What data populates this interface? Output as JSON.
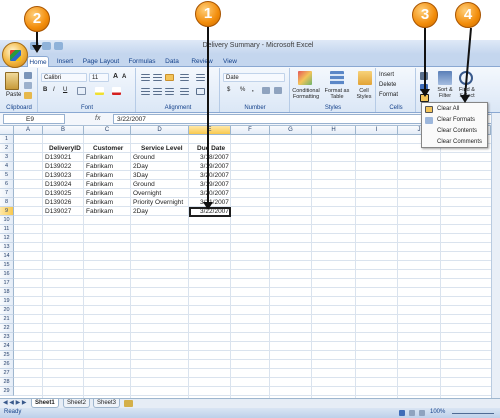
{
  "window": {
    "title": "Delivery Summary - Microsoft Excel"
  },
  "tabs": [
    "Home",
    "Insert",
    "Page Layout",
    "Formulas",
    "Data",
    "Review",
    "View"
  ],
  "ribbon": {
    "clipboard": {
      "label": "Clipboard",
      "paste": "Paste"
    },
    "font": {
      "label": "Font",
      "name": "Calibri",
      "size": "11",
      "bold": "B",
      "italic": "I",
      "underline": "U",
      "grow": "A",
      "shrink": "A"
    },
    "alignment": {
      "label": "Alignment"
    },
    "number": {
      "label": "Number",
      "format": "Date",
      "currency": "$",
      "percent": "%",
      "comma": ","
    },
    "styles": {
      "label": "Styles",
      "conditional": "Conditional Formatting",
      "format_table": "Format as Table",
      "cell_styles": "Cell Styles"
    },
    "cells": {
      "label": "Cells",
      "insert": "Insert",
      "delete": "Delete",
      "format": "Format"
    },
    "editing": {
      "sort": "Sort & Filter",
      "find": "Find & Select"
    }
  },
  "formula_bar": {
    "name_box": "E9",
    "fx": "fx",
    "value": "3/22/2007"
  },
  "columns": [
    "A",
    "B",
    "C",
    "D",
    "E",
    "F",
    "G",
    "H",
    "I",
    "J",
    "K"
  ],
  "rows": [
    "1",
    "2",
    "3",
    "4",
    "5",
    "6",
    "7",
    "8",
    "9",
    "10",
    "11",
    "12",
    "13",
    "14",
    "15",
    "16",
    "17",
    "18",
    "19",
    "20",
    "21",
    "22",
    "23",
    "24",
    "25",
    "26",
    "27",
    "28",
    "29"
  ],
  "headers": [
    "DeliveryID",
    "Customer",
    "Service Level",
    "Due Date"
  ],
  "data_rows": [
    [
      "D139021",
      "Fabrikam",
      "Ground",
      "3/18/2007"
    ],
    [
      "D139022",
      "Fabrikam",
      "2Day",
      "3/19/2007"
    ],
    [
      "D139023",
      "Fabrikam",
      "3Day",
      "3/20/2007"
    ],
    [
      "D139024",
      "Fabrikam",
      "Ground",
      "3/19/2007"
    ],
    [
      "D139025",
      "Fabrikam",
      "Overnight",
      "3/20/2007"
    ],
    [
      "D139026",
      "Fabrikam",
      "Priority Overnight",
      "3/21/2007"
    ],
    [
      "D139027",
      "Fabrikam",
      "2Day",
      "3/22/2007"
    ]
  ],
  "clear_menu": [
    "Clear All",
    "Clear Formats",
    "Clear Contents",
    "Clear Comments"
  ],
  "sheets": [
    "Sheet1",
    "Sheet2",
    "Sheet3"
  ],
  "status": {
    "ready": "Ready",
    "zoom": "100%"
  },
  "callouts": [
    "1",
    "2",
    "3",
    "4"
  ],
  "colors": {
    "ribbon_bg": "#dbe7f6",
    "callout": "#f28c0a",
    "accent": "#15428b"
  }
}
